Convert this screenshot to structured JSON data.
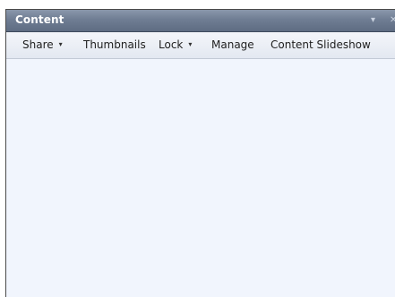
{
  "panel": {
    "title": "Content",
    "title_buttons": {
      "menu_glyph": "▾",
      "close_glyph": "✕"
    }
  },
  "toolbar": {
    "items": [
      {
        "label": "Share",
        "has_dropdown": true,
        "caret": "▾"
      },
      {
        "label": "Thumbnails",
        "has_dropdown": false
      },
      {
        "label": "Lock",
        "has_dropdown": true,
        "caret": "▾"
      },
      {
        "label": "Manage",
        "has_dropdown": false
      },
      {
        "label": "Content Slideshow",
        "has_dropdown": false
      }
    ]
  },
  "colors": {
    "titlebar": "#6f7d93",
    "toolbar": "#e3e8f1",
    "content_background": "#f1f5fd"
  }
}
